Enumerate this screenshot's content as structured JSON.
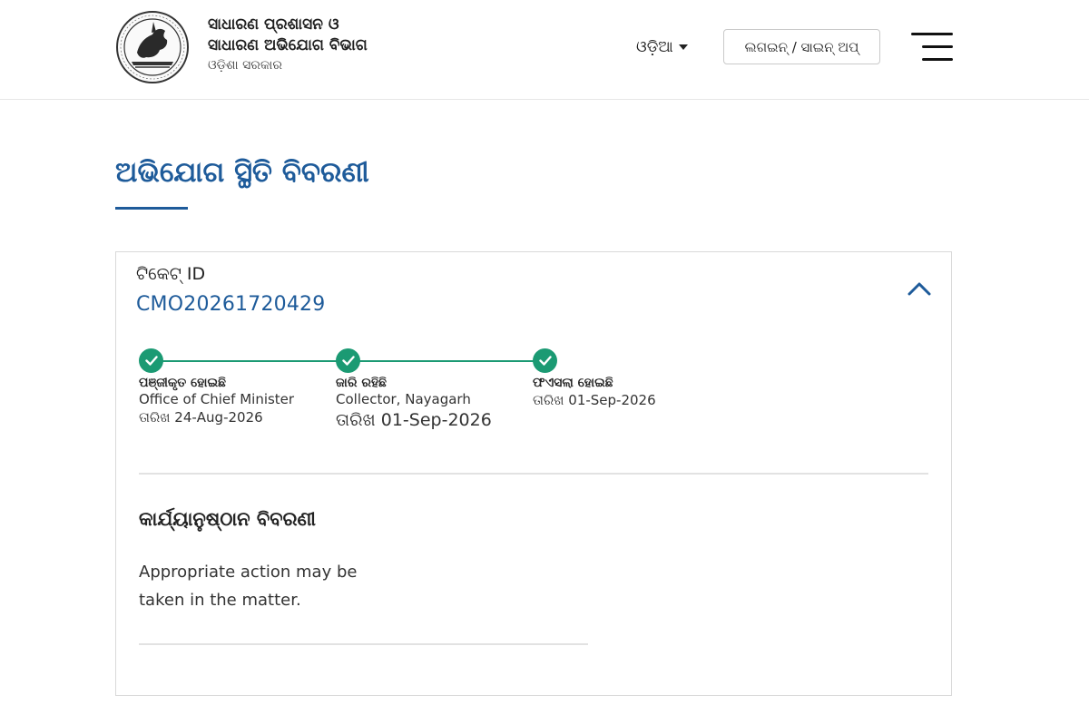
{
  "header": {
    "org_line1": "ସାଧାରଣ ପ୍ରଶାସନ ଓ",
    "org_line2": "ସାଧାରଣ ଅଭିଯୋଗ ବିଭାଗ",
    "org_sub": "ଓଡ଼ିଶା ସରକାର",
    "language": "ଓଡ଼ିଆ",
    "login_label": "ଲଗଇନ୍ / ସାଇନ୍ ଅପ୍",
    "emblem_icon": "odisha-emblem-icon",
    "menu_icon": "hamburger-menu-icon"
  },
  "page": {
    "title": "ଅଭିଯୋଗ ସ୍ଥିତି ବିବରଣୀ"
  },
  "ticket": {
    "label": "ଟିକେଟ୍ ID",
    "id": "CMO20261720429",
    "collapse_icon": "chevron-up-icon"
  },
  "timeline": [
    {
      "title": "ପଞ୍ଜୀକୃତ ହୋଇଛି",
      "office": "Office of Chief Minister",
      "date": "ତାରିଖ 24-Aug-2026",
      "status": "completed"
    },
    {
      "title": "ଜାରି ରହିଛି",
      "office": "Collector, Nayagarh",
      "date": "ତାରିଖ 01-Sep-2026",
      "status": "completed"
    },
    {
      "title": "ଫଏସଲା ହୋଇଛି",
      "office": "",
      "date": "ତାରିଖ 01-Sep-2026",
      "status": "completed"
    }
  ],
  "action": {
    "title": "କାର୍ଯ୍ୟାନୁଷ୍ଠାନ ବିବରଣୀ",
    "text": "Appropriate action may be taken in the matter."
  },
  "colors": {
    "accent": "#1e5b9a",
    "success": "#1b9a73"
  }
}
